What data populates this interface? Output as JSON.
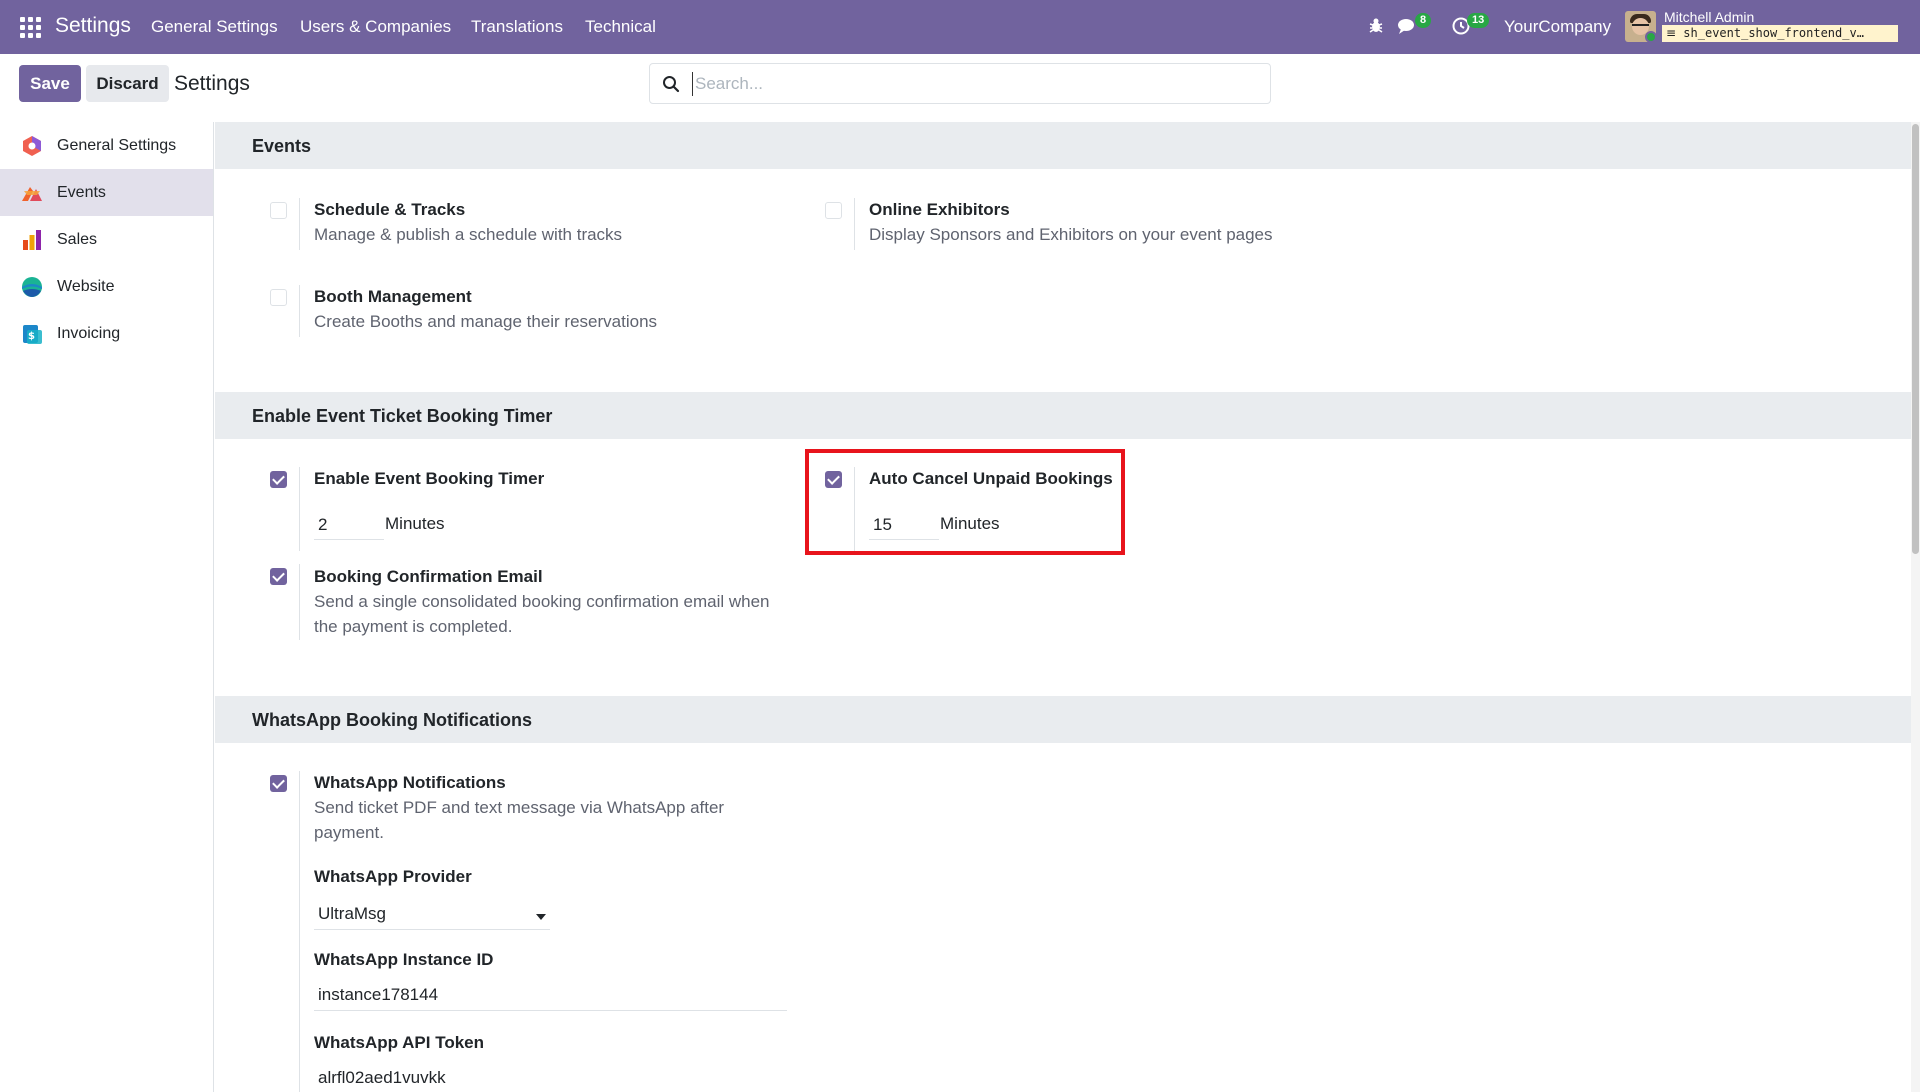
{
  "navbar": {
    "brand": "Settings",
    "menu": [
      "General Settings",
      "Users & Companies",
      "Translations",
      "Technical"
    ],
    "messages_count": "8",
    "activities_count": "13",
    "company": "YourCompany",
    "user_name": "Mitchell Admin",
    "db_name": "sh_event_show_frontend_v…"
  },
  "control": {
    "save_label": "Save",
    "discard_label": "Discard",
    "title": "Settings",
    "search_placeholder": "Search..."
  },
  "sidebar": {
    "items": [
      {
        "label": "General Settings",
        "icon": "settings-app-icon",
        "color": "#f06050"
      },
      {
        "label": "Events",
        "icon": "events-app-icon",
        "color": "#f0622c"
      },
      {
        "label": "Sales",
        "icon": "sales-app-icon",
        "color": "#e64a19"
      },
      {
        "label": "Website",
        "icon": "website-app-icon",
        "color": "#1ab394"
      },
      {
        "label": "Invoicing",
        "icon": "invoicing-app-icon",
        "color": "#1c87c9"
      }
    ]
  },
  "events": {
    "header": "Events",
    "schedule_title": "Schedule & Tracks",
    "schedule_desc": "Manage & publish a schedule with tracks",
    "exhibitors_title": "Online Exhibitors",
    "exhibitors_desc": "Display Sponsors and Exhibitors on your event pages",
    "booth_title": "Booth Management",
    "booth_desc": "Create Booths and manage their reservations"
  },
  "timer": {
    "header": "Enable Event Ticket Booking Timer",
    "enable_title": "Enable Event Booking Timer",
    "enable_value": "2",
    "enable_unit": "Minutes",
    "auto_cancel_title": "Auto Cancel Unpaid Bookings",
    "auto_cancel_value": "15",
    "auto_cancel_unit": "Minutes",
    "confirm_title": "Booking Confirmation Email",
    "confirm_desc_1": "Send a single consolidated booking confirmation email when",
    "confirm_desc_2": "the payment is completed."
  },
  "whatsapp": {
    "header": "WhatsApp Booking Notifications",
    "notif_title": "WhatsApp Notifications",
    "notif_desc_1": "Send ticket PDF and text message via WhatsApp after",
    "notif_desc_2": "payment.",
    "provider_label": "WhatsApp Provider",
    "provider_value": "UltraMsg",
    "instance_label": "WhatsApp Instance ID",
    "instance_value": "instance178144",
    "token_label": "WhatsApp API Token",
    "token_value": "alrfl02aed1vuvkk"
  },
  "colors": {
    "brand": "#71639e",
    "highlight": "#e8141c",
    "badge": "#28a745"
  }
}
